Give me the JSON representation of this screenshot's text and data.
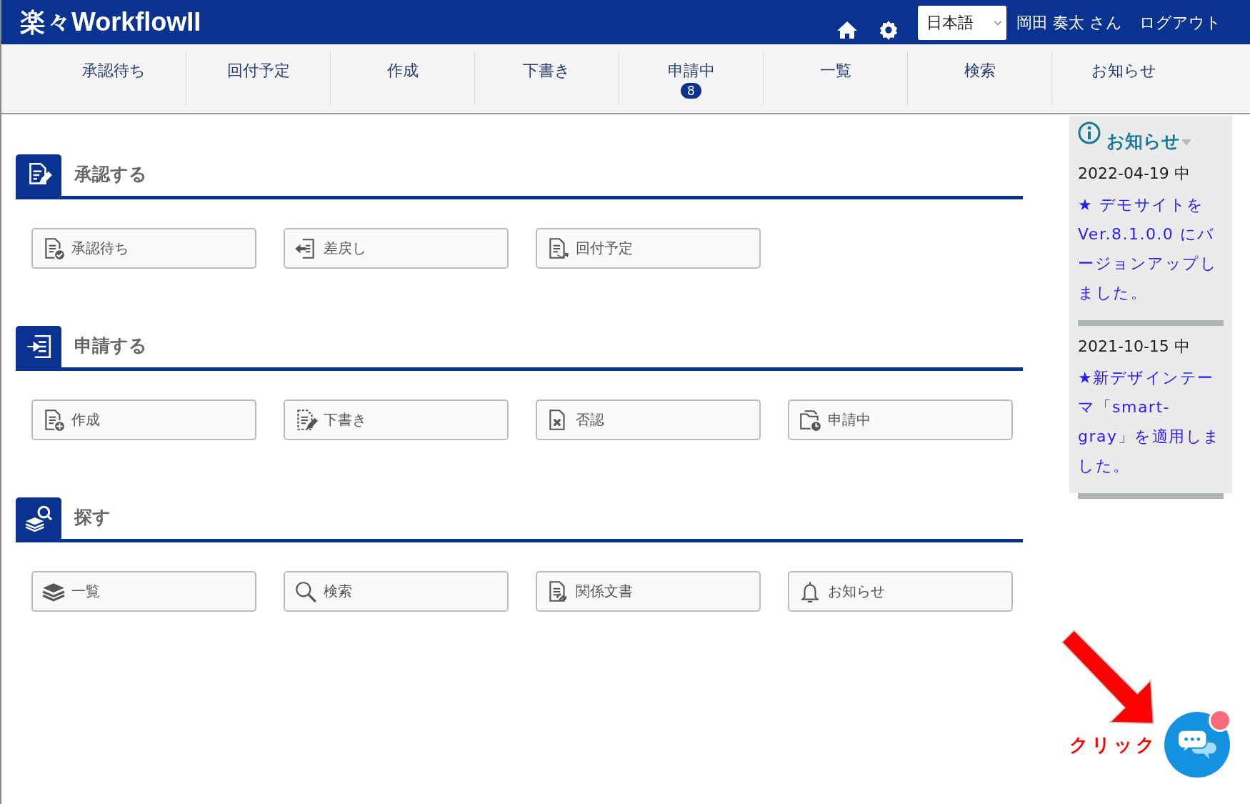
{
  "header": {
    "logo": "楽々WorkflowII",
    "language": "日本語",
    "user": "岡田 奏太 さん",
    "logout": "ログアウト"
  },
  "nav": [
    {
      "label": "承認待ち"
    },
    {
      "label": "回付予定"
    },
    {
      "label": "作成"
    },
    {
      "label": "下書き"
    },
    {
      "label": "申請中",
      "badge": "8"
    },
    {
      "label": "一覧"
    },
    {
      "label": "検索"
    },
    {
      "label": "お知らせ"
    }
  ],
  "sections": [
    {
      "title": "承認する",
      "buttons": [
        "承認待ち",
        "差戻し",
        "回付予定"
      ]
    },
    {
      "title": "申請する",
      "buttons": [
        "作成",
        "下書き",
        "否認",
        "申請中"
      ]
    },
    {
      "title": "探す",
      "buttons": [
        "一覧",
        "検索",
        "関係文書",
        "お知らせ"
      ]
    }
  ],
  "notices": {
    "title": "お知らせ",
    "items": [
      {
        "date": "2022-04-19 中",
        "text": "★ デモサイトを Ver.8.1.0.0 にバージョンアップしました。"
      },
      {
        "date": "2021-10-15 中",
        "text": "★新デザインテーマ「smart-gray」を適用しました。"
      }
    ]
  },
  "annotation": {
    "label": "クリック"
  }
}
